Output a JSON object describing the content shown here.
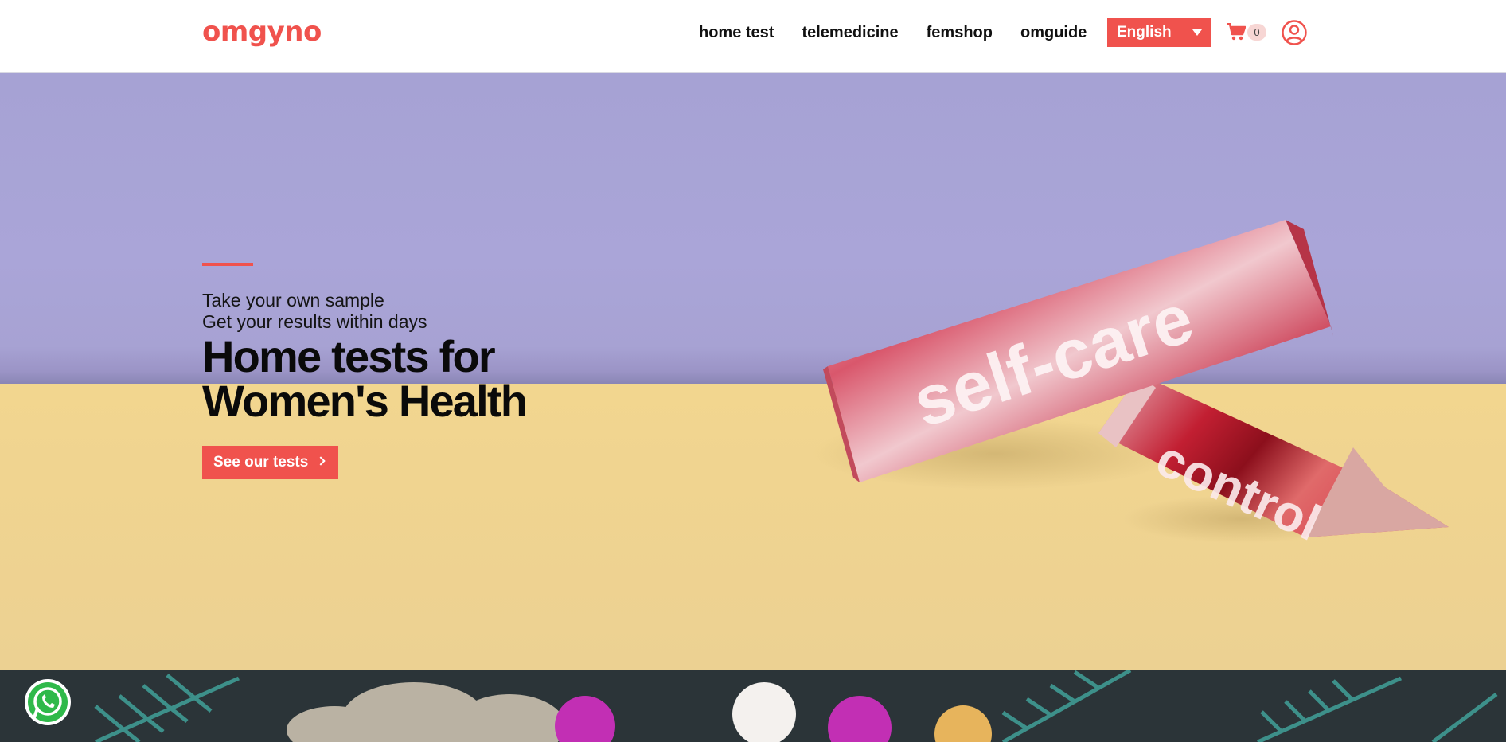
{
  "brand": {
    "logo_text": "omgyno",
    "accent": "#f0524d"
  },
  "nav": {
    "items": [
      {
        "label": "home test"
      },
      {
        "label": "telemedicine"
      },
      {
        "label": "femshop"
      },
      {
        "label": "omguide"
      }
    ]
  },
  "language": {
    "selected": "English"
  },
  "cart": {
    "count": "0",
    "icon": "cart-icon"
  },
  "account": {
    "icon": "user-circle-icon"
  },
  "hero": {
    "subline_1": "Take your own sample",
    "subline_2": "Get your results within days",
    "headline_line_1": "Home tests for",
    "headline_line_2": "Women's Health",
    "cta_label": "See our tests",
    "product_text_1": "self-care",
    "product_text_2": "control",
    "wall_color": "#a6a2d4",
    "table_color": "#f0d490"
  },
  "floating": {
    "whatsapp_icon": "whatsapp-icon"
  }
}
